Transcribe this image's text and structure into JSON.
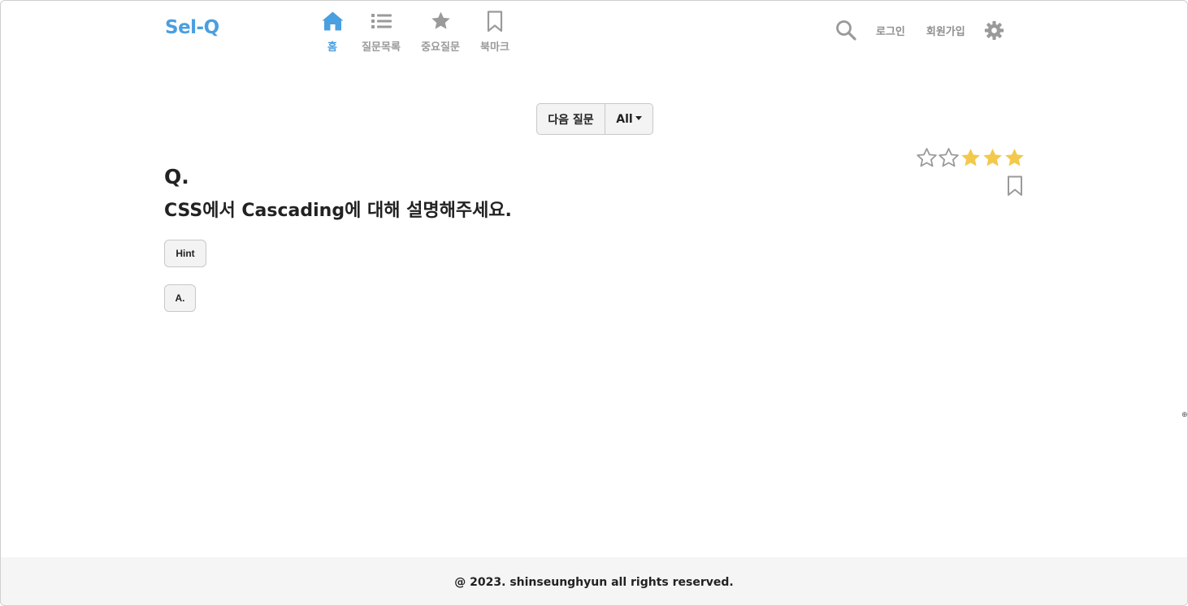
{
  "header": {
    "logo": "Sel-Q",
    "nav": [
      {
        "label": "홈",
        "icon": "home-icon",
        "active": true
      },
      {
        "label": "질문목록",
        "icon": "list-icon",
        "active": false
      },
      {
        "label": "중요질문",
        "icon": "star-icon",
        "active": false
      },
      {
        "label": "북마크",
        "icon": "bookmark-icon",
        "active": false
      }
    ],
    "login_label": "로그인",
    "signup_label": "회원가입",
    "search_icon": "search-icon",
    "settings_icon": "gear-icon"
  },
  "controls": {
    "next_label": "다음 질문",
    "filter_label": "All"
  },
  "question": {
    "label": "Q.",
    "text": "CSS에서 Cascading에 대해 설명해주세요.",
    "hint_label": "Hint",
    "answer_label": "A.",
    "rating": {
      "filled": 3,
      "total": 5
    }
  },
  "colors": {
    "accent": "#4a9fe0",
    "star_filled": "#f2c94c",
    "star_empty": "#9a9a9a",
    "muted": "#9a9a9a"
  },
  "footer": {
    "text": "@ 2023. shinseunghyun all rights reserved."
  }
}
